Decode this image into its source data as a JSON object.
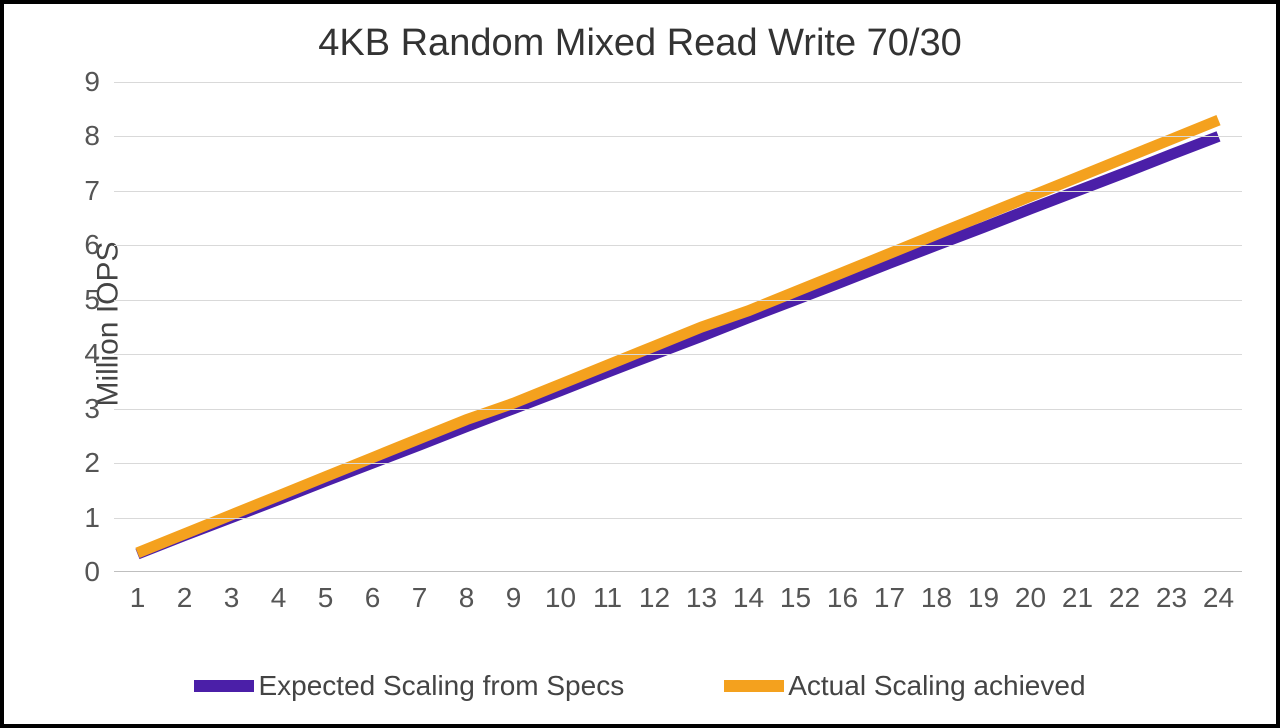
{
  "title": "4KB Random Mixed Read Write 70/30",
  "yaxis_label": "Million IOPS",
  "legend": {
    "expected": "Expected Scaling from Specs",
    "actual": "Actual Scaling achieved"
  },
  "colors": {
    "expected": "#4b1fa8",
    "actual": "#f4a11e",
    "grid": "#d9d9d9"
  },
  "chart_data": {
    "type": "line",
    "title": "4KB Random Mixed Read Write 70/30",
    "xlabel": "",
    "ylabel": "Million IOPS",
    "xlim": [
      1,
      24
    ],
    "ylim": [
      0,
      9
    ],
    "categories": [
      1,
      2,
      3,
      4,
      5,
      6,
      7,
      8,
      9,
      10,
      11,
      12,
      13,
      14,
      15,
      16,
      17,
      18,
      19,
      20,
      21,
      22,
      23,
      24
    ],
    "y_ticks": [
      0,
      1,
      2,
      3,
      4,
      5,
      6,
      7,
      8,
      9
    ],
    "series": [
      {
        "name": "Expected Scaling from Specs",
        "color": "#4b1fa8",
        "values": [
          0.33,
          0.67,
          1.0,
          1.33,
          1.67,
          2.0,
          2.33,
          2.67,
          3.0,
          3.33,
          3.67,
          4.0,
          4.33,
          4.67,
          5.0,
          5.33,
          5.67,
          6.0,
          6.33,
          6.67,
          7.0,
          7.33,
          7.67,
          8.0
        ]
      },
      {
        "name": "Actual Scaling achieved",
        "color": "#f4a11e",
        "values": [
          0.35,
          0.7,
          1.05,
          1.4,
          1.75,
          2.1,
          2.45,
          2.8,
          3.1,
          3.45,
          3.8,
          4.15,
          4.5,
          4.8,
          5.15,
          5.5,
          5.85,
          6.2,
          6.55,
          6.9,
          7.25,
          7.6,
          7.95,
          8.3
        ]
      }
    ]
  }
}
